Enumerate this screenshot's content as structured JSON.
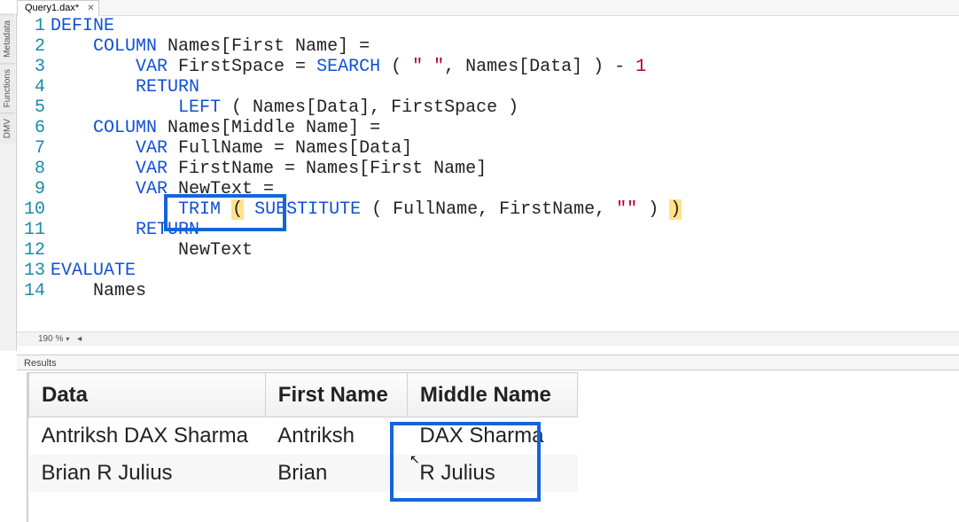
{
  "tab": {
    "label": "Query1.dax*",
    "close": "✕"
  },
  "sidebar": {
    "items": [
      "Metadata",
      "Functions",
      "DMV"
    ]
  },
  "zoom": {
    "label": "190 %",
    "marker": "◂"
  },
  "results_label": "Results",
  "code": {
    "lines": [
      {
        "n": "1",
        "seg": [
          {
            "t": "DEFINE",
            "c": "kw"
          }
        ]
      },
      {
        "n": "2",
        "seg": [
          {
            "t": "    ",
            "c": "txt"
          },
          {
            "t": "COLUMN",
            "c": "kw"
          },
          {
            "t": " Names[First Name] =",
            "c": "txt"
          }
        ]
      },
      {
        "n": "3",
        "seg": [
          {
            "t": "        ",
            "c": "txt"
          },
          {
            "t": "VAR",
            "c": "kw"
          },
          {
            "t": " FirstSpace = ",
            "c": "txt"
          },
          {
            "t": "SEARCH",
            "c": "fn"
          },
          {
            "t": " ( ",
            "c": "txt"
          },
          {
            "t": "\" \"",
            "c": "str"
          },
          {
            "t": ", Names[Data] ) - ",
            "c": "txt"
          },
          {
            "t": "1",
            "c": "num"
          }
        ]
      },
      {
        "n": "4",
        "seg": [
          {
            "t": "        ",
            "c": "txt"
          },
          {
            "t": "RETURN",
            "c": "kw"
          }
        ]
      },
      {
        "n": "5",
        "seg": [
          {
            "t": "            ",
            "c": "txt"
          },
          {
            "t": "LEFT",
            "c": "fn"
          },
          {
            "t": " ( Names[Data], FirstSpace )",
            "c": "txt"
          }
        ]
      },
      {
        "n": "6",
        "seg": [
          {
            "t": "    ",
            "c": "txt"
          },
          {
            "t": "COLUMN",
            "c": "kw"
          },
          {
            "t": " Names[Middle Name] =",
            "c": "txt"
          }
        ]
      },
      {
        "n": "7",
        "seg": [
          {
            "t": "        ",
            "c": "txt"
          },
          {
            "t": "VAR",
            "c": "kw"
          },
          {
            "t": " FullName = Names[Data]",
            "c": "txt"
          }
        ]
      },
      {
        "n": "8",
        "seg": [
          {
            "t": "        ",
            "c": "txt"
          },
          {
            "t": "VAR",
            "c": "kw"
          },
          {
            "t": " FirstName = Names[First Name]",
            "c": "txt"
          }
        ]
      },
      {
        "n": "9",
        "seg": [
          {
            "t": "        ",
            "c": "txt"
          },
          {
            "t": "VAR",
            "c": "kw"
          },
          {
            "t": " NewText =",
            "c": "txt"
          }
        ]
      },
      {
        "n": "10",
        "seg": [
          {
            "t": "            ",
            "c": "txt"
          },
          {
            "t": "TRIM",
            "c": "fn"
          },
          {
            "t": " ",
            "c": "txt"
          },
          {
            "t": "(",
            "c": "paren-hl"
          },
          {
            "t": " ",
            "c": "txt"
          },
          {
            "t": "SUBSTITUTE",
            "c": "fn"
          },
          {
            "t": " ( FullName, FirstName, ",
            "c": "txt"
          },
          {
            "t": "\"\"",
            "c": "str"
          },
          {
            "t": " ) ",
            "c": "txt"
          },
          {
            "t": ")",
            "c": "paren-hl"
          }
        ]
      },
      {
        "n": "11",
        "seg": [
          {
            "t": "        ",
            "c": "txt"
          },
          {
            "t": "RETURN",
            "c": "kw"
          }
        ]
      },
      {
        "n": "12",
        "seg": [
          {
            "t": "            NewText",
            "c": "txt"
          }
        ]
      },
      {
        "n": "13",
        "seg": [
          {
            "t": "EVALUATE",
            "c": "kw"
          }
        ]
      },
      {
        "n": "14",
        "seg": [
          {
            "t": "    Names",
            "c": "txt"
          }
        ]
      }
    ]
  },
  "results": {
    "columns": [
      "Data",
      "First Name",
      "Middle Name"
    ],
    "rows": [
      [
        "Antriksh DAX Sharma",
        "Antriksh",
        "DAX Sharma"
      ],
      [
        "Brian R Julius",
        "Brian",
        "R Julius"
      ]
    ]
  }
}
